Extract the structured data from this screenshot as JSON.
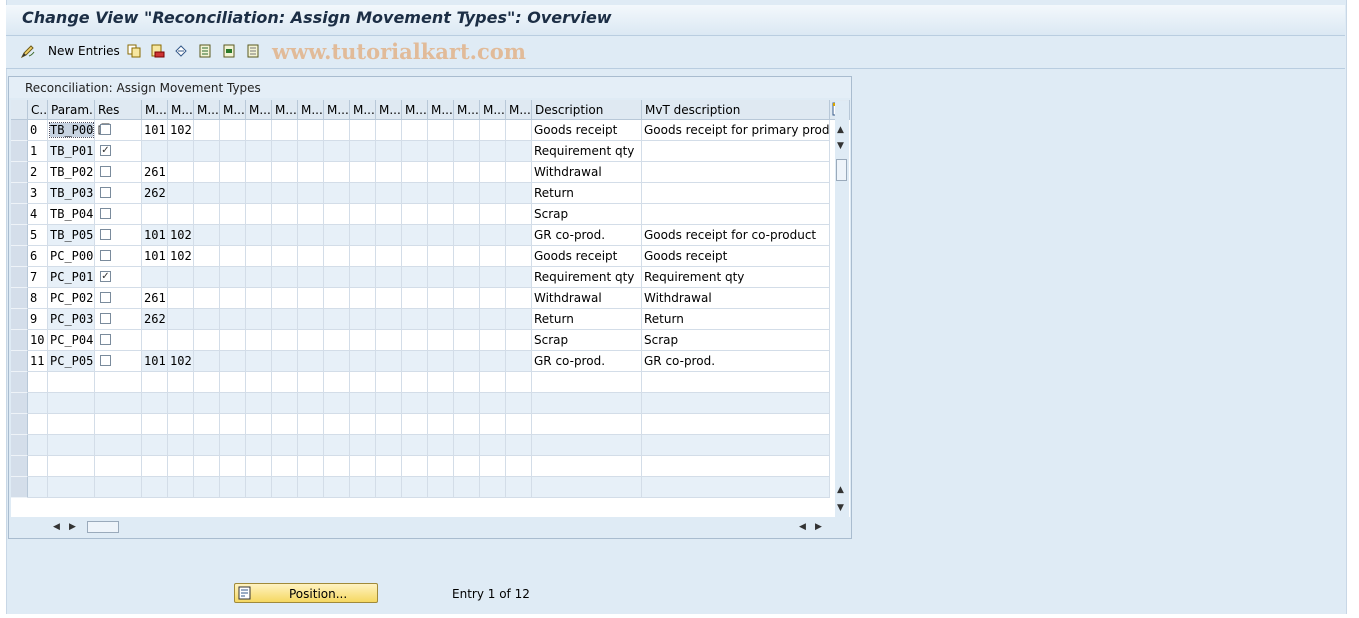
{
  "window": {
    "title": "Change View \"Reconciliation: Assign Movement Types\": Overview"
  },
  "toolbar": {
    "new_entries_label": "New Entries",
    "icons": [
      "edit-pencil-icon",
      "copy-icon",
      "delete-icon",
      "undo-icon",
      "select-all-icon",
      "select-block-icon",
      "deselect-icon"
    ],
    "watermark": "www.tutorialkart.com"
  },
  "panel": {
    "title": "Reconciliation: Assign Movement Types"
  },
  "table": {
    "headers": [
      "C..",
      "Param.",
      "Res",
      "M...",
      "M...",
      "M...",
      "M...",
      "M...",
      "M...",
      "M...",
      "M...",
      "M...",
      "M...",
      "M...",
      "M...",
      "M...",
      "M...",
      "M...",
      "Description",
      "MvT description"
    ],
    "rows": [
      {
        "c": "0",
        "param": "TB_P00",
        "res": false,
        "m1": "101",
        "m2": "102",
        "desc": "Goods receipt",
        "mvt": "Goods receipt for primary product"
      },
      {
        "c": "1",
        "param": "TB_P01",
        "res": true,
        "m1": "",
        "m2": "",
        "desc": "Requirement qty",
        "mvt": ""
      },
      {
        "c": "2",
        "param": "TB_P02",
        "res": false,
        "m1": "261",
        "m2": "",
        "desc": "Withdrawal",
        "mvt": ""
      },
      {
        "c": "3",
        "param": "TB_P03",
        "res": false,
        "m1": "262",
        "m2": "",
        "desc": "Return",
        "mvt": ""
      },
      {
        "c": "4",
        "param": "TB_P04",
        "res": false,
        "m1": "",
        "m2": "",
        "desc": "Scrap",
        "mvt": ""
      },
      {
        "c": "5",
        "param": "TB_P05",
        "res": false,
        "m1": "101",
        "m2": "102",
        "desc": "GR co-prod.",
        "mvt": "Goods receipt for co-product"
      },
      {
        "c": "6",
        "param": "PC_P00",
        "res": false,
        "m1": "101",
        "m2": "102",
        "desc": "Goods receipt",
        "mvt": "Goods receipt"
      },
      {
        "c": "7",
        "param": "PC_P01",
        "res": true,
        "m1": "",
        "m2": "",
        "desc": "Requirement qty",
        "mvt": "Requirement qty"
      },
      {
        "c": "8",
        "param": "PC_P02",
        "res": false,
        "m1": "261",
        "m2": "",
        "desc": "Withdrawal",
        "mvt": "Withdrawal"
      },
      {
        "c": "9",
        "param": "PC_P03",
        "res": false,
        "m1": "262",
        "m2": "",
        "desc": "Return",
        "mvt": "Return"
      },
      {
        "c": "10",
        "param": "PC_P04",
        "res": false,
        "m1": "",
        "m2": "",
        "desc": "Scrap",
        "mvt": "Scrap"
      },
      {
        "c": "11",
        "param": "PC_P05",
        "res": false,
        "m1": "101",
        "m2": "102",
        "desc": "GR co-prod.",
        "mvt": "GR co-prod."
      }
    ]
  },
  "footer": {
    "position_button": "Position...",
    "entry_text": "Entry 1 of 12"
  }
}
